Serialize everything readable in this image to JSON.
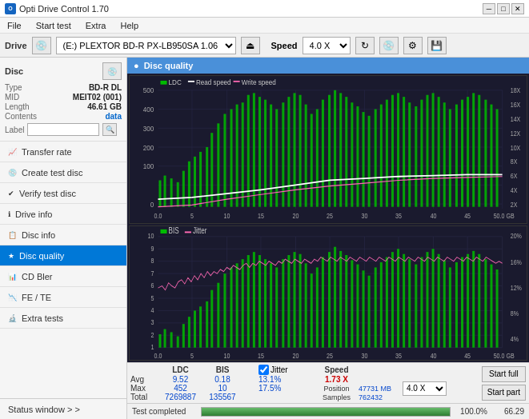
{
  "titlebar": {
    "title": "Opti Drive Control 1.70",
    "icon": "O",
    "controls": [
      "_",
      "□",
      "×"
    ]
  },
  "menubar": {
    "items": [
      "File",
      "Start test",
      "Extra",
      "Help"
    ]
  },
  "drivebar": {
    "drive_label": "Drive",
    "drive_value": "(E:) PLEXTOR BD-R  PX-LB950SA 1.06",
    "speed_label": "Speed",
    "speed_value": "4.0 X"
  },
  "sidebar": {
    "disc": {
      "type_label": "Type",
      "type_value": "BD-R DL",
      "mid_label": "MID",
      "mid_value": "MEIT02 (001)",
      "length_label": "Length",
      "length_value": "46.61 GB",
      "contents_label": "Contents",
      "contents_value": "data",
      "label_label": "Label",
      "label_value": ""
    },
    "nav_items": [
      {
        "id": "transfer-rate",
        "label": "Transfer rate",
        "icon": "📈"
      },
      {
        "id": "create-test-disc",
        "label": "Create test disc",
        "icon": "💿"
      },
      {
        "id": "verify-test-disc",
        "label": "Verify test disc",
        "icon": "✔"
      },
      {
        "id": "drive-info",
        "label": "Drive info",
        "icon": "ℹ"
      },
      {
        "id": "disc-info",
        "label": "Disc info",
        "icon": "📋"
      },
      {
        "id": "disc-quality",
        "label": "Disc quality",
        "icon": "★",
        "active": true
      },
      {
        "id": "cd-bler",
        "label": "CD Bler",
        "icon": "📊"
      },
      {
        "id": "fe-te",
        "label": "FE / TE",
        "icon": "📉"
      },
      {
        "id": "extra-tests",
        "label": "Extra tests",
        "icon": "🔬"
      }
    ],
    "status_window": "Status window > >"
  },
  "content": {
    "title": "Disc quality",
    "chart1": {
      "legend": [
        {
          "label": "LDC",
          "color": "#00aa00"
        },
        {
          "label": "Read speed",
          "color": "#ffffff"
        },
        {
          "label": "Write speed",
          "color": "#ff69b4"
        }
      ],
      "y_axis_left": [
        500,
        400,
        300,
        200,
        100,
        0
      ],
      "y_axis_right": [
        "18X",
        "16X",
        "14X",
        "12X",
        "10X",
        "8X",
        "6X",
        "4X",
        "2X"
      ],
      "x_axis": [
        0,
        5,
        10,
        15,
        20,
        25,
        30,
        35,
        40,
        45,
        "50.0 GB"
      ]
    },
    "chart2": {
      "legend": [
        {
          "label": "BIS",
          "color": "#00aa00"
        },
        {
          "label": "Jitter",
          "color": "#ff69b4"
        }
      ],
      "y_axis_left": [
        10,
        9,
        8,
        7,
        6,
        5,
        4,
        3,
        2,
        1
      ],
      "y_axis_right": [
        "20%",
        "16%",
        "12%",
        "8%",
        "4%"
      ],
      "x_axis": [
        0,
        5,
        10,
        15,
        20,
        25,
        30,
        35,
        40,
        45,
        "50.0 GB"
      ]
    }
  },
  "stats": {
    "headers": [
      "",
      "LDC",
      "BIS",
      "",
      "Jitter",
      "Speed",
      "",
      ""
    ],
    "avg_label": "Avg",
    "avg_ldc": "9.52",
    "avg_bis": "0.18",
    "avg_jitter": "13.1%",
    "max_label": "Max",
    "max_ldc": "452",
    "max_bis": "10",
    "max_jitter": "17.5%",
    "total_label": "Total",
    "total_ldc": "7269887",
    "total_bis": "135567",
    "jitter_checked": true,
    "speed_label": "Speed",
    "speed_value": "1.73 X",
    "speed_select": "4.0 X",
    "position_label": "Position",
    "position_value": "47731 MB",
    "samples_label": "Samples",
    "samples_value": "762432",
    "btn_start_full": "Start full",
    "btn_start_part": "Start part"
  },
  "progress": {
    "status_text": "Test completed",
    "percent": "100.0%",
    "speed": "66.29"
  }
}
